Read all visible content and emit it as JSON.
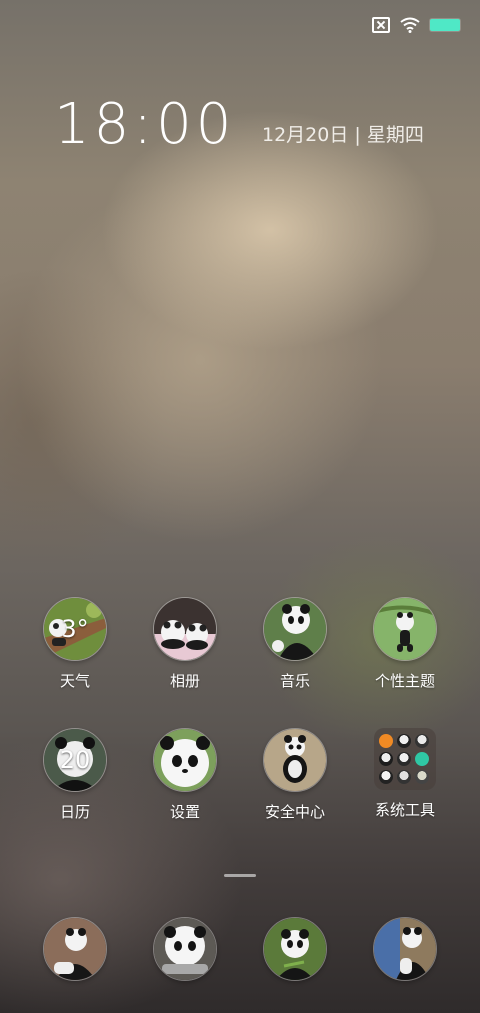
{
  "status_bar": {
    "icons": [
      "no-sim-icon",
      "wifi-icon",
      "battery-icon"
    ],
    "battery_color": "#4fe8c6"
  },
  "clock": {
    "time": "18:00",
    "date": "12月20日 | 星期四"
  },
  "apps": [
    {
      "label": "天气",
      "icon_text": "3°"
    },
    {
      "label": "相册"
    },
    {
      "label": "音乐"
    },
    {
      "label": "个性主题"
    },
    {
      "label": "日历",
      "icon_text": "20"
    },
    {
      "label": "设置"
    },
    {
      "label": "安全中心"
    },
    {
      "label": "系统工具"
    }
  ],
  "dock": {
    "apps": [
      "phone-app-icon",
      "messages-app-icon",
      "browser-app-icon",
      "camera-app-icon"
    ]
  }
}
